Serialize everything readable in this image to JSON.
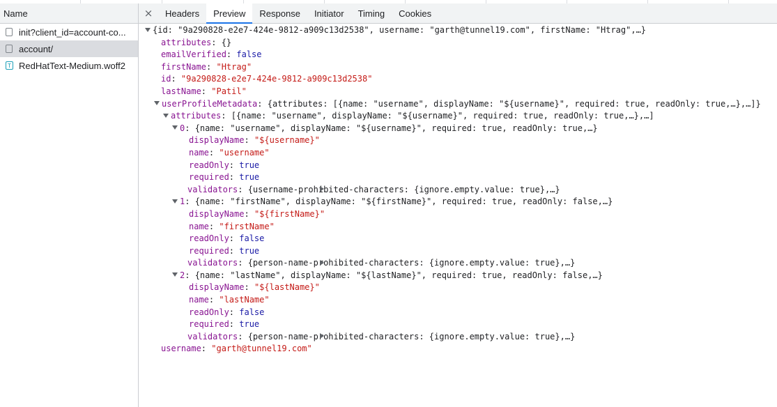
{
  "sidebar": {
    "header": "Name",
    "requests": [
      {
        "label": "init?client_id=account-co...",
        "icon": "document-icon"
      },
      {
        "label": "account/",
        "icon": "document-icon"
      },
      {
        "label": "RedHatText-Medium.woff2",
        "icon": "font-file-icon"
      }
    ]
  },
  "tabs": {
    "close": "×",
    "items": [
      "Headers",
      "Preview",
      "Response",
      "Initiator",
      "Timing",
      "Cookies"
    ],
    "active": "Preview"
  },
  "preview": {
    "root_summary": "{id: \"9a290828-e2e7-424e-9812-a909c13d2538\", username: \"garth@tunnel19.com\", firstName: \"Htrag\",…}",
    "attributes": {
      "key": "attributes",
      "value": "{}"
    },
    "emailVerified": {
      "key": "emailVerified",
      "value": "false"
    },
    "firstName": {
      "key": "firstName",
      "value": "\"Htrag\""
    },
    "id": {
      "key": "id",
      "value": "\"9a290828-e2e7-424e-9812-a909c13d2538\""
    },
    "lastName": {
      "key": "lastName",
      "value": "\"Patil\""
    },
    "userProfileMetadata": {
      "key": "userProfileMetadata",
      "summary": "{attributes: [{name: \"username\", displayName: \"${username}\", required: true, readOnly: true,…},…]}"
    },
    "upm_attributes": {
      "key": "attributes",
      "summary": "[{name: \"username\", displayName: \"${username}\", required: true, readOnly: true,…},…]"
    },
    "items": [
      {
        "index": "0",
        "summary": "{name: \"username\", displayName: \"${username}\", required: true, readOnly: true,…}",
        "displayName": "\"${username}\"",
        "name": "\"username\"",
        "readOnly": "true",
        "required": "true",
        "validators": "{username-prohibited-characters: {ignore.empty.value: true},…}"
      },
      {
        "index": "1",
        "summary": "{name: \"firstName\", displayName: \"${firstName}\", required: true, readOnly: false,…}",
        "displayName": "\"${firstName}\"",
        "name": "\"firstName\"",
        "readOnly": "false",
        "required": "true",
        "validators": "{person-name-prohibited-characters: {ignore.empty.value: true},…}"
      },
      {
        "index": "2",
        "summary": "{name: \"lastName\", displayName: \"${lastName}\", required: true, readOnly: false,…}",
        "displayName": "\"${lastName}\"",
        "name": "\"lastName\"",
        "readOnly": "false",
        "required": "true",
        "validators": "{person-name-prohibited-characters: {ignore.empty.value: true},…}"
      }
    ],
    "keys": {
      "displayName": "displayName",
      "name": "name",
      "readOnly": "readOnly",
      "required": "required",
      "validators": "validators"
    },
    "username": {
      "key": "username",
      "value": "\"garth@tunnel19.com\""
    }
  },
  "colors": {
    "key": "#881391",
    "string": "#c41a16",
    "keyword": "#1a1aa6",
    "tab_active": "#1a73e8"
  }
}
